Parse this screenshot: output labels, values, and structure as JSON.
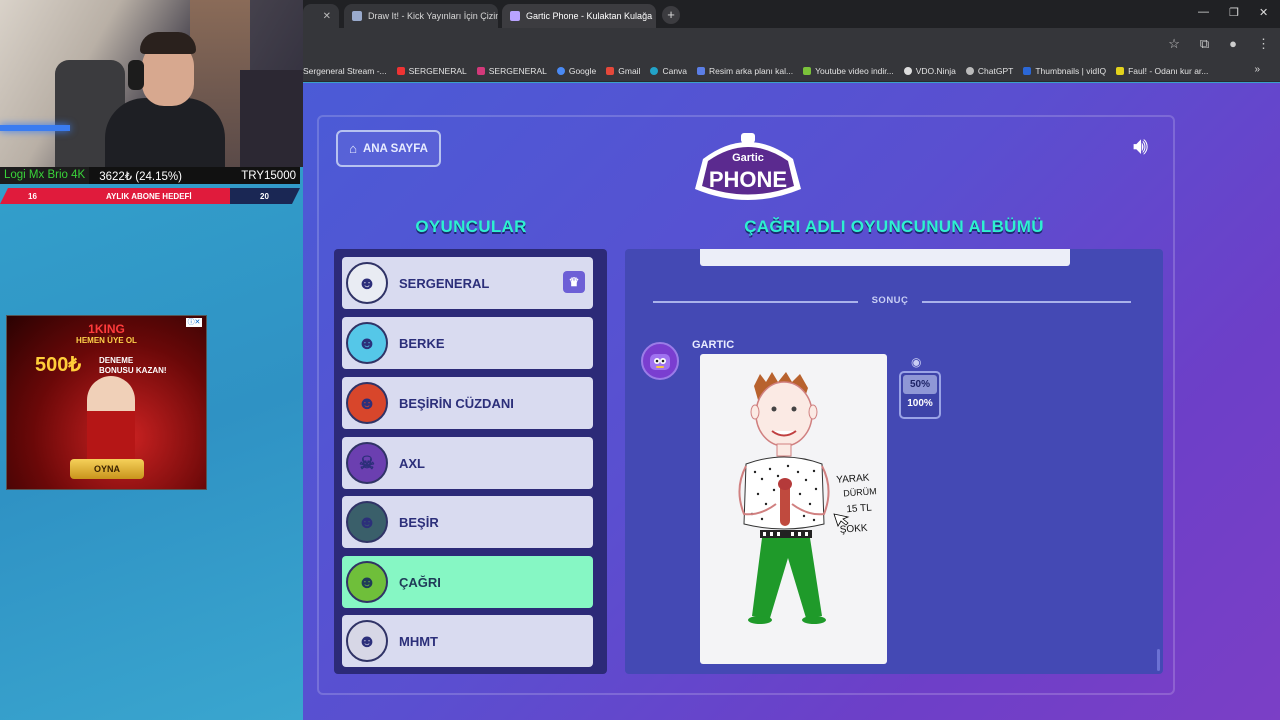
{
  "browser": {
    "tabs": [
      {
        "label": "",
        "active": false
      },
      {
        "label": "Draw It! - Kick Yayınları İçin Çizim",
        "active": false
      },
      {
        "label": "Gartic Phone - Kulaktan Kulağa",
        "active": true
      }
    ],
    "new_tab": "+",
    "win_controls": [
      "—",
      "❐",
      "✕"
    ],
    "bookmarks": [
      "Sergeneral Stream -...",
      "SERGENERAL",
      "SERGENERAL",
      "Google",
      "Gmail",
      "Canva",
      "Resim arka planı kal...",
      "Youtube video indir...",
      "VDO.Ninja",
      "ChatGPT",
      "Thumbnails | vidIQ",
      "Faul! - Odanı kur ar..."
    ]
  },
  "overlay": {
    "camera_label": "Logi Mx Brio 4K",
    "goal_value": "3622₺ (24.15%)",
    "goal_target": "TRY15000",
    "goal_bar": {
      "left": "16",
      "label": "AYLIK ABONE HEDEFİ",
      "right": "20"
    }
  },
  "ad": {
    "brand": "1KING",
    "line1": "HEMEN ÜYE OL",
    "amount": "500₺",
    "line2": "DENEME",
    "line3": "BONUSU KAZAN!",
    "button": "OYNA"
  },
  "game": {
    "home_button": "ANA SAYFA",
    "logo_top": "Gartic",
    "logo_bottom": "PHONE",
    "players_title": "OYUNCULAR",
    "album_title": "ÇAĞRI ADLI OYUNCUNUN ALBÜMÜ",
    "players": [
      {
        "name": "SERGENERAL",
        "selected": false,
        "host": true,
        "color": "#e9ecf3",
        "face": "☻"
      },
      {
        "name": "BERKE",
        "selected": false,
        "host": false,
        "color": "#55c7e8",
        "face": "☻"
      },
      {
        "name": "BEŞİRİN CÜZDANI",
        "selected": false,
        "host": false,
        "color": "#d8462b",
        "face": "☻"
      },
      {
        "name": "AXL",
        "selected": false,
        "host": false,
        "color": "#6b3fb0",
        "face": "☠"
      },
      {
        "name": "BEŞİR",
        "selected": false,
        "host": false,
        "color": "#3a5f6a",
        "face": "☻"
      },
      {
        "name": "ÇAĞRI",
        "selected": true,
        "host": false,
        "color": "#6fbf3a",
        "face": "☻"
      },
      {
        "name": "MHMT",
        "selected": false,
        "host": false,
        "color": "#d7d7e6",
        "face": "☻"
      }
    ],
    "result_label": "SONUÇ",
    "author": "GARTIC",
    "speed_options": [
      "50%",
      "100%"
    ],
    "drawing_note": [
      "YARAK",
      "DÜRÜM",
      "15 TL",
      "ŞOKK"
    ]
  }
}
